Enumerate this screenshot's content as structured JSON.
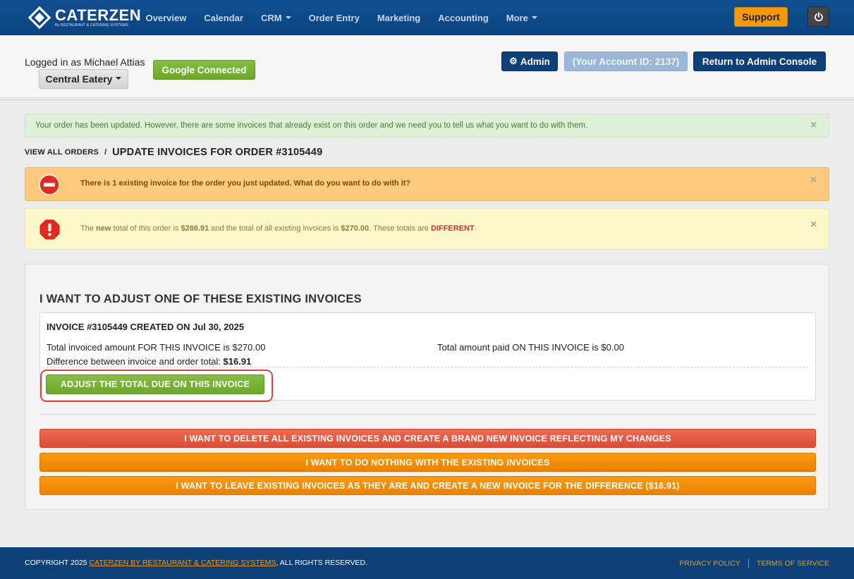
{
  "nav": {
    "brand": "CATERZEN",
    "brand_tagline": "By RESTAURANT & CATERING SYSTEMS",
    "items": [
      {
        "label": "Overview",
        "dropdown": false
      },
      {
        "label": "Calendar",
        "dropdown": false
      },
      {
        "label": "CRM",
        "dropdown": true
      },
      {
        "label": "Order Entry",
        "dropdown": false
      },
      {
        "label": "Marketing",
        "dropdown": false
      },
      {
        "label": "Accounting",
        "dropdown": false
      },
      {
        "label": "More",
        "dropdown": true
      }
    ],
    "support_label": "Support",
    "power_icon": "power-icon"
  },
  "account": {
    "logged_in_text": "Logged in as Michael Attias",
    "location_label": "Central Eatery",
    "google_label": "Google Connected",
    "admin_label": "Admin",
    "account_id_label": "(Your Account ID: 2137)",
    "console_label": "Return to Admin Console"
  },
  "alerts": {
    "success_text": "Your order has been updated. However, there are some invoices that already exist on this order and we need you to tell us what you want to do with them.",
    "warning_text": "There is 1 existing invoice for the order you just updated. What do you want to do with it?",
    "info": {
      "pre": "The ",
      "new": "new",
      "mid1": " total of this order is ",
      "order_total": "$286.91",
      "mid2": " and the total of all existing invoices is ",
      "invoices_total": "$270.00",
      "mid3": ". These totals are ",
      "different": "DIFFERENT",
      "end": "."
    },
    "close_glyph": "×"
  },
  "breadcrumb": {
    "link": "VIEW ALL ORDERS",
    "sep": "/",
    "title": "UPDATE INVOICES FOR ORDER #3105449"
  },
  "panel": {
    "title": "I WANT TO ADJUST ONE OF THESE EXISTING INVOICES",
    "invoice": {
      "title": "INVOICE #3105449 CREATED ON Jul 30, 2025",
      "invoiced_text": "Total invoiced amount FOR THIS INVOICE is $270.00",
      "paid_text": "Total amount paid ON THIS INVOICE is $0.00",
      "diff_label": "Difference between invoice and order total: ",
      "diff_value": "$16.91",
      "adjust_label": "ADJUST THE TOTAL DUE ON THIS INVOICE"
    },
    "delete_label": "I WANT TO DELETE ALL EXISTING INVOICES AND CREATE A BRAND NEW INVOICE REFLECTING MY CHANGES",
    "nothing_label": "I WANT TO DO NOTHING WITH THE EXISTING INVOICES",
    "leave_label": "I WANT TO LEAVE EXISTING INVOICES AS THEY ARE AND CREATE A NEW INVOICE FOR THE DIFFERENCE ($16.91)"
  },
  "footer": {
    "copyright_pre": "COPYRIGHT 2025 ",
    "copyright_link": "CATERZEN BY RESTAURANT & CATERING SYSTEMS",
    "copyright_post": ", ALL RIGHTS RESERVED.",
    "privacy": "PRIVACY POLICY",
    "terms": "TERMS OF SERVICE"
  },
  "colors": {
    "nav_bg": "#0d4a8a",
    "support": "#f4980f",
    "green": "#6ca72a",
    "red": "#dc4d38",
    "orange": "#ec8200",
    "highlight": "#d9453d"
  }
}
